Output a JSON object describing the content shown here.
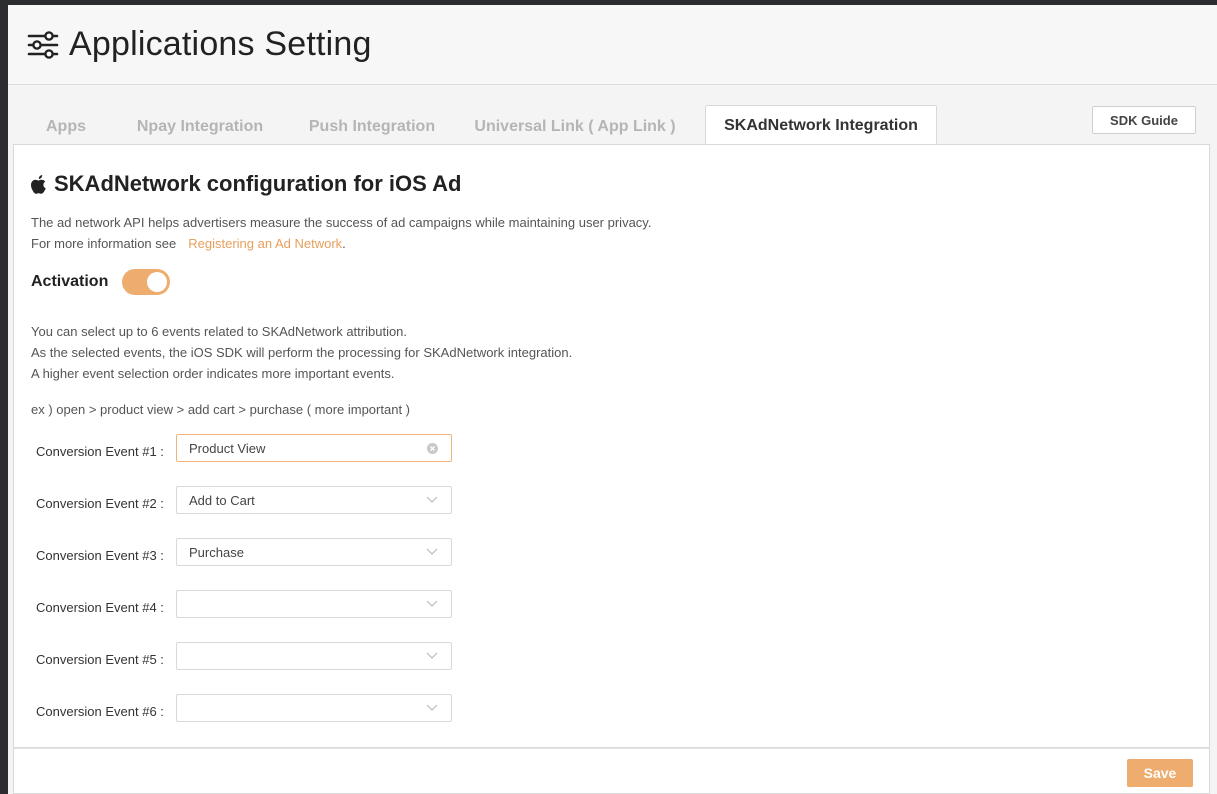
{
  "header": {
    "title": "Applications Setting",
    "icon": "sliders-icon"
  },
  "tabs": [
    {
      "label": "Apps",
      "active": false
    },
    {
      "label": "Npay Integration",
      "active": false
    },
    {
      "label": "Push Integration",
      "active": false
    },
    {
      "label": "Universal Link ( App Link )",
      "active": false
    },
    {
      "label": "SKAdNetwork Integration",
      "active": true
    }
  ],
  "sdk_guide_label": "SDK Guide",
  "section": {
    "title": "SKAdNetwork configuration for iOS Ad",
    "icon": "apple-icon",
    "description_line1": "The ad network API helps advertisers measure the success of ad campaigns while maintaining user privacy.",
    "description_line2_prefix": "For more information see",
    "link_text": "Registering an Ad Network",
    "link_suffix": "."
  },
  "activation": {
    "label": "Activation",
    "enabled": true
  },
  "info": {
    "line1": "You can select up to 6 events related to SKAdNetwork attribution.",
    "line2": "As the selected events, the iOS SDK will perform the processing for SKAdNetwork integration.",
    "line3": "A higher event selection order indicates more important events.",
    "example": "ex ) open > product view > add cart > purchase ( more important )"
  },
  "events": [
    {
      "label": "Conversion Event #1 :",
      "value": "Product View"
    },
    {
      "label": "Conversion Event #2 :",
      "value": "Add to Cart"
    },
    {
      "label": "Conversion Event #3 :",
      "value": "Purchase"
    },
    {
      "label": "Conversion Event #4 :",
      "value": ""
    },
    {
      "label": "Conversion Event #5 :",
      "value": ""
    },
    {
      "label": "Conversion Event #6 :",
      "value": ""
    }
  ],
  "footer": {
    "save_label": "Save"
  },
  "colors": {
    "accent": "#eeac6e",
    "link": "#e79f5c",
    "inactive_tab": "#b5b5b5"
  }
}
